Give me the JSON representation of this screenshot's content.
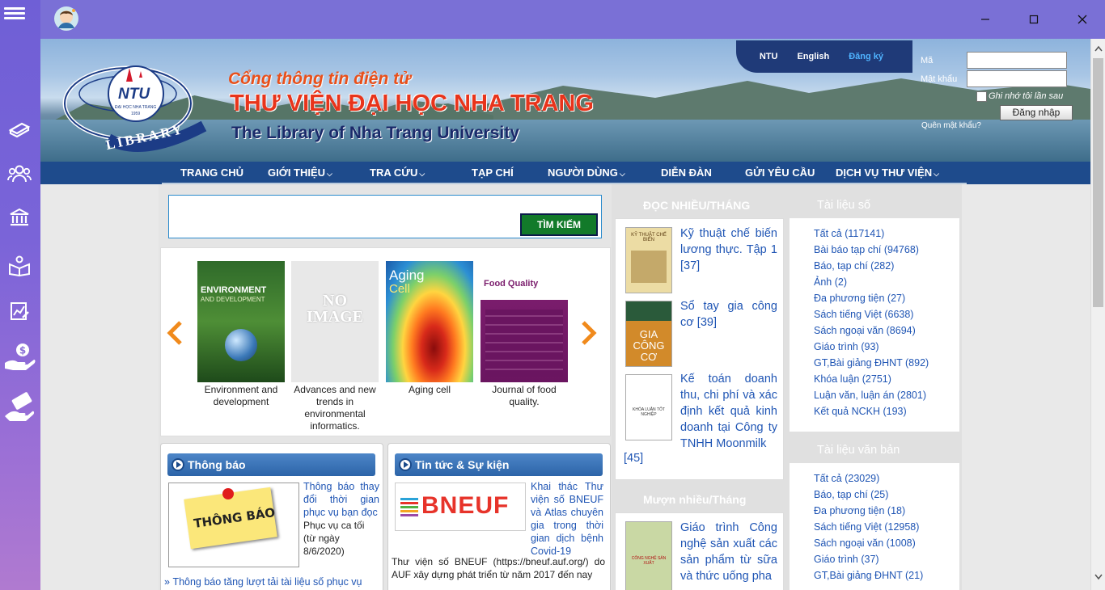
{
  "rail": {
    "icons": [
      "menu-icon",
      "books-icon",
      "users-icon",
      "library-building-icon",
      "reading-icon",
      "chart-icon",
      "money-hand-icon",
      "payment-icon"
    ]
  },
  "banner": {
    "line1": "Cổng thông tin điện tử",
    "line2": "THƯ VIỆN ĐẠI HỌC NHA TRANG",
    "line3": "The Library of Nha Trang University",
    "logo": {
      "abbr": "NTU",
      "univ": "ĐẠI HỌC NHA TRANG",
      "year": "1959",
      "ring": "LIBRARY"
    }
  },
  "lang": {
    "ntu": "NTU",
    "english": "English",
    "register": "Đăng ký"
  },
  "login": {
    "code_label": "Mã",
    "password_label": "Mật khẩu",
    "remember": "Ghi nhớ tôi lần sau",
    "submit": "Đăng nhập",
    "forgot": "Quên mật khẩu?"
  },
  "nav": [
    "TRANG CHỦ",
    "GIỚI THIỆU",
    "TRA CỨU",
    "TẠP CHÍ",
    "NGƯỜI DÙNG",
    "DIỄN ĐÀN",
    "GỬI YÊU CẦU",
    "DỊCH VỤ THƯ VIỆN"
  ],
  "search": {
    "value": "",
    "button": "TÌM KIẾM"
  },
  "carousel": [
    {
      "title": "Environment and development",
      "cover_line1": "ENVIRONMENT",
      "cover_line2": "AND DEVELOPMENT"
    },
    {
      "title": "Advances and new trends in environmental informatics.",
      "cover_line1": "NO",
      "cover_line2": "IMAGE"
    },
    {
      "title": "Aging cell",
      "cover_line1": "Aging",
      "cover_line2": "Cell"
    },
    {
      "title": "Journal of food quality.",
      "cover_line1": "Food Quality",
      "cover_line2": ""
    }
  ],
  "notice": {
    "title": "Thông báo",
    "image_text": "THÔNG BÁO",
    "link": "Thông báo thay đổi thời gian phục vụ bạn đọc",
    "desc": "Phục vụ ca tối (từ ngày 8/6/2020)",
    "next": "Thông báo tăng lượt tải tài liệu số phục vụ"
  },
  "news": {
    "title": "Tin tức & Sự kiện",
    "logo_text": "BNEUF",
    "link": "Khai thác Thư viện số BNEUF và Atlas chuyên gia trong thời gian dịch bệnh Covid-19",
    "desc": "Thư viện số BNEUF (https://bneuf.auf.org/) do AUF xây dựng phát triển từ năm 2017 đến nay"
  },
  "most_read": {
    "title": "ĐỌC NHIỀU/THÁNG",
    "items": [
      {
        "text": "Kỹ thuật chế biến lương thực. Tập 1",
        "count": "[37]",
        "cover": "KỸ THUẬT CHẾ BIẾN"
      },
      {
        "text": "Sổ tay gia công cơ",
        "count": "[39]",
        "cover": "GIA CÔNG CƠ"
      },
      {
        "text": "Kế toán doanh thu, chi phí và xác định kết quả kinh doanh tại Công ty TNHH Moonmilk",
        "count": "[45]",
        "cover": "KHÓA LUẬN TỐT NGHIỆP"
      }
    ]
  },
  "most_borrowed": {
    "title": "Mượn nhiều/Tháng",
    "items": [
      {
        "text": "Giáo trình Công nghệ sản xuất các sản phẩm từ sữa và thức uống pha",
        "cover": "CÔNG NGHỆ SẢN XUẤT"
      }
    ]
  },
  "digital": {
    "title": "Tài liệu số",
    "items": [
      "Tất cả (117141)",
      "Bài báo tạp chí (94768)",
      "Báo, tạp chí (282)",
      "Ảnh (2)",
      "Đa phương tiện (27)",
      "Sách tiếng Việt (6638)",
      "Sách ngoại văn (8694)",
      "Giáo trình (93)",
      "GT,Bài giảng ĐHNT (892)",
      "Khóa luận (2751)",
      "Luận văn, luận án (2801)",
      "Kết quả NCKH (193)"
    ]
  },
  "print": {
    "title": "Tài liệu văn bản",
    "items": [
      "Tất cả (23029)",
      "Báo, tạp chí (25)",
      "Đa phương tiện (18)",
      "Sách tiếng Việt (12958)",
      "Sách ngoại văn (1008)",
      "Giáo trình (37)",
      "GT,Bài giảng ĐHNT (21)"
    ]
  },
  "colors": {
    "rail_top": "#6f5fd6",
    "titlebar": "#7a70d6",
    "nav": "#1e4b8c",
    "link": "#1f55b4",
    "banner_red": "#e8341b",
    "search_btn": "#127a2a"
  }
}
